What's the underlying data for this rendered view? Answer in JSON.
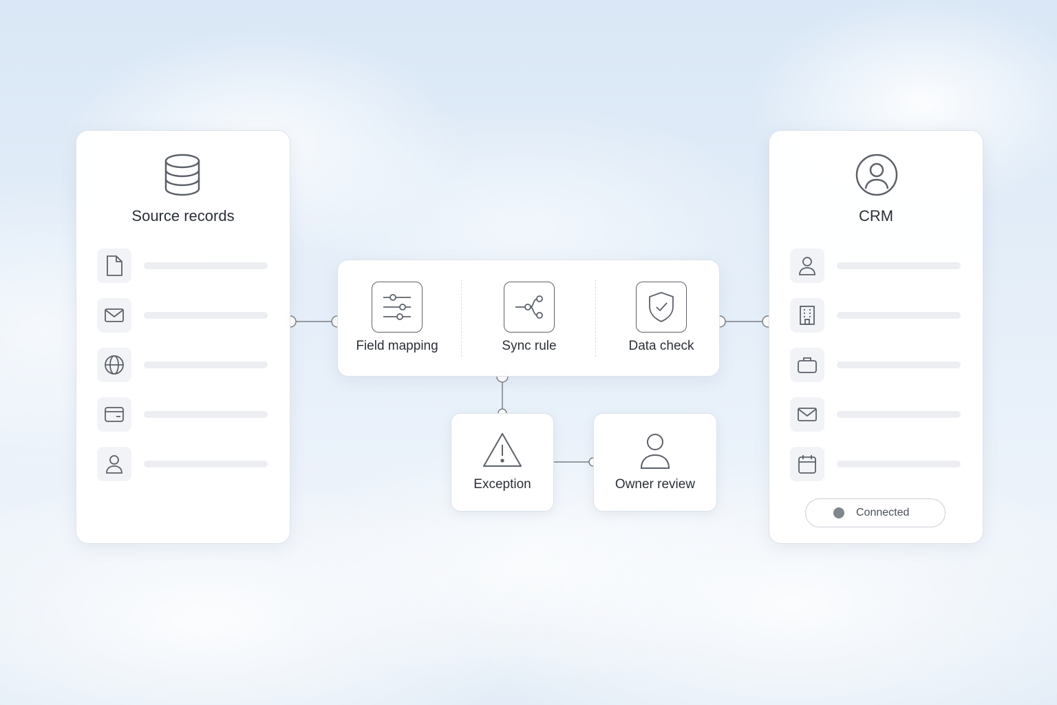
{
  "colors": {
    "icon_stroke": "#5b6068",
    "connector": "#7a7f87",
    "status_dot": "#7f868e"
  },
  "source_panel": {
    "title": "Source records",
    "header_icon": "database-icon",
    "rows": [
      {
        "icon": "document-icon"
      },
      {
        "icon": "mail-icon"
      },
      {
        "icon": "globe-icon"
      },
      {
        "icon": "credit-card-icon"
      },
      {
        "icon": "user-icon"
      }
    ]
  },
  "pipeline": {
    "steps": [
      {
        "label": "Field mapping",
        "icon": "sliders-icon"
      },
      {
        "label": "Sync rule",
        "icon": "branch-icon"
      },
      {
        "label": "Data check",
        "icon": "shield-check-icon"
      }
    ]
  },
  "exception": {
    "label": "Exception",
    "icon": "warning-icon"
  },
  "owner_review": {
    "label": "Owner review",
    "icon": "user-icon"
  },
  "crm_panel": {
    "title": "CRM",
    "header_icon": "user-circle-icon",
    "rows": [
      {
        "icon": "user-icon"
      },
      {
        "icon": "building-icon"
      },
      {
        "icon": "briefcase-icon"
      },
      {
        "icon": "mail-icon"
      },
      {
        "icon": "calendar-icon"
      }
    ],
    "status": "Connected"
  }
}
